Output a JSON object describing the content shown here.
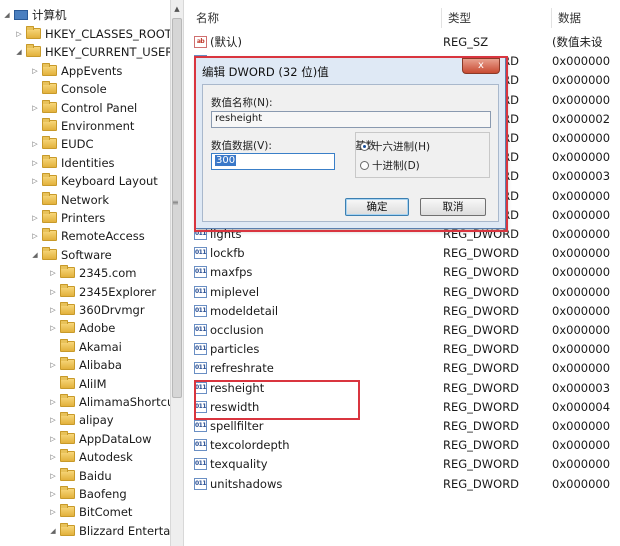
{
  "tree": {
    "root": "计算机",
    "items": [
      {
        "label": "HKEY_CLASSES_ROOT",
        "level": 1,
        "expander": "collapsed"
      },
      {
        "label": "HKEY_CURRENT_USER",
        "level": 1,
        "expander": "expanded"
      },
      {
        "label": "AppEvents",
        "level": 2,
        "expander": "collapsed"
      },
      {
        "label": "Console",
        "level": 2,
        "expander": "none"
      },
      {
        "label": "Control Panel",
        "level": 2,
        "expander": "collapsed"
      },
      {
        "label": "Environment",
        "level": 2,
        "expander": "none"
      },
      {
        "label": "EUDC",
        "level": 2,
        "expander": "collapsed"
      },
      {
        "label": "Identities",
        "level": 2,
        "expander": "collapsed"
      },
      {
        "label": "Keyboard Layout",
        "level": 2,
        "expander": "collapsed"
      },
      {
        "label": "Network",
        "level": 2,
        "expander": "none"
      },
      {
        "label": "Printers",
        "level": 2,
        "expander": "collapsed"
      },
      {
        "label": "RemoteAccess",
        "level": 2,
        "expander": "collapsed"
      },
      {
        "label": "Software",
        "level": 2,
        "expander": "expanded"
      },
      {
        "label": "2345.com",
        "level": 3,
        "expander": "collapsed"
      },
      {
        "label": "2345Explorer",
        "level": 3,
        "expander": "collapsed"
      },
      {
        "label": "360Drvmgr",
        "level": 3,
        "expander": "collapsed"
      },
      {
        "label": "Adobe",
        "level": 3,
        "expander": "collapsed"
      },
      {
        "label": "Akamai",
        "level": 3,
        "expander": "none"
      },
      {
        "label": "Alibaba",
        "level": 3,
        "expander": "collapsed"
      },
      {
        "label": "AliIM",
        "level": 3,
        "expander": "none"
      },
      {
        "label": "AlimamaShortcu",
        "level": 3,
        "expander": "collapsed"
      },
      {
        "label": "alipay",
        "level": 3,
        "expander": "collapsed"
      },
      {
        "label": "AppDataLow",
        "level": 3,
        "expander": "collapsed"
      },
      {
        "label": "Autodesk",
        "level": 3,
        "expander": "collapsed"
      },
      {
        "label": "Baidu",
        "level": 3,
        "expander": "collapsed"
      },
      {
        "label": "Baofeng",
        "level": 3,
        "expander": "collapsed"
      },
      {
        "label": "BitComet",
        "level": 3,
        "expander": "collapsed"
      },
      {
        "label": "Blizzard Entertai",
        "level": 3,
        "expander": "expanded"
      }
    ]
  },
  "list": {
    "columns": {
      "name": "名称",
      "type": "类型",
      "data": "数据"
    },
    "rows": [
      {
        "name": "(默认)",
        "type": "REG_SZ",
        "data": "(数值未设",
        "icon": "ab"
      },
      {
        "name": "",
        "type": "REG_DWORD",
        "data": "0x000000",
        "icon": "dword"
      },
      {
        "name": "",
        "type": "REG_DWORD",
        "data": "0x000000",
        "icon": "dword"
      },
      {
        "name": "",
        "type": "REG_DWORD",
        "data": "0x000000",
        "icon": "dword"
      },
      {
        "name": "",
        "type": "REG_DWORD",
        "data": "0x000002",
        "icon": "dword"
      },
      {
        "name": "",
        "type": "REG_DWORD",
        "data": "0x000000",
        "icon": "dword"
      },
      {
        "name": "",
        "type": "REG_DWORD",
        "data": "0x000000",
        "icon": "dword"
      },
      {
        "name": "",
        "type": "REG_DWORD",
        "data": "0x000003",
        "icon": "dword"
      },
      {
        "name": "",
        "type": "REG_DWORD",
        "data": "0x000000",
        "icon": "dword"
      },
      {
        "name": "",
        "type": "REG_DWORD",
        "data": "0x000000",
        "icon": "dword"
      },
      {
        "name": "lights",
        "type": "REG_DWORD",
        "data": "0x000000",
        "icon": "dword"
      },
      {
        "name": "lockfb",
        "type": "REG_DWORD",
        "data": "0x000000",
        "icon": "dword"
      },
      {
        "name": "maxfps",
        "type": "REG_DWORD",
        "data": "0x000000",
        "icon": "dword"
      },
      {
        "name": "miplevel",
        "type": "REG_DWORD",
        "data": "0x000000",
        "icon": "dword"
      },
      {
        "name": "modeldetail",
        "type": "REG_DWORD",
        "data": "0x000000",
        "icon": "dword"
      },
      {
        "name": "occlusion",
        "type": "REG_DWORD",
        "data": "0x000000",
        "icon": "dword"
      },
      {
        "name": "particles",
        "type": "REG_DWORD",
        "data": "0x000000",
        "icon": "dword"
      },
      {
        "name": "refreshrate",
        "type": "REG_DWORD",
        "data": "0x000000",
        "icon": "dword"
      },
      {
        "name": "resheight",
        "type": "REG_DWORD",
        "data": "0x000003",
        "icon": "dword"
      },
      {
        "name": "reswidth",
        "type": "REG_DWORD",
        "data": "0x000004",
        "icon": "dword"
      },
      {
        "name": "spellfilter",
        "type": "REG_DWORD",
        "data": "0x000000",
        "icon": "dword"
      },
      {
        "name": "texcolordepth",
        "type": "REG_DWORD",
        "data": "0x000000",
        "icon": "dword"
      },
      {
        "name": "texquality",
        "type": "REG_DWORD",
        "data": "0x000000",
        "icon": "dword"
      },
      {
        "name": "unitshadows",
        "type": "REG_DWORD",
        "data": "0x000000",
        "icon": "dword"
      }
    ]
  },
  "dialog": {
    "title": "编辑 DWORD (32 位)值",
    "close_glyph": "x",
    "value_name_label": "数值名称(N):",
    "value_name": "resheight",
    "value_data_label": "数值数据(V):",
    "value_data": "300",
    "base_label": "基数",
    "hex_label": "十六进制(H)",
    "dec_label": "十进制(D)",
    "selected_base": "hex",
    "ok_label": "确定",
    "cancel_label": "取消"
  },
  "colors": {
    "highlight_box": "#d9353f",
    "dialog_frame": "#5a7fae",
    "dialog_bg": "#dfe9f5"
  }
}
